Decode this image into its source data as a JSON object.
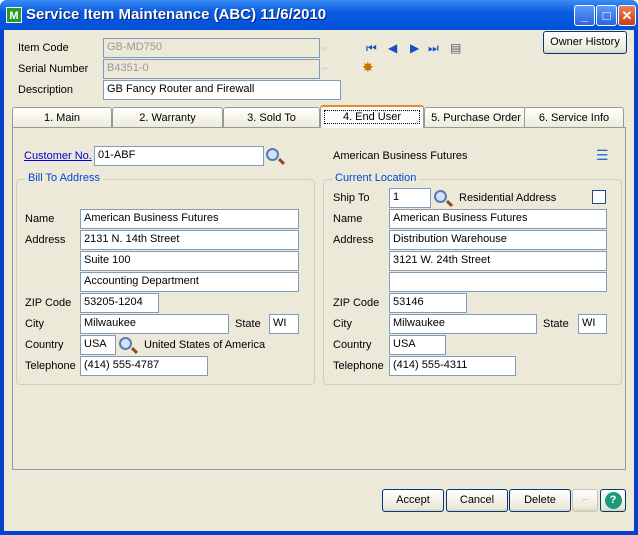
{
  "window": {
    "title": "Service Item Maintenance (ABC) 11/6/2010",
    "app_icon": "M"
  },
  "header": {
    "item_code_label": "Item Code",
    "item_code": "GB-MD750",
    "serial_label": "Serial Number",
    "serial": "B4351-0",
    "description_label": "Description",
    "description": "GB Fancy Router and Firewall",
    "owner_history": "Owner History"
  },
  "tabs": [
    "1. Main",
    "2. Warranty",
    "3. Sold To",
    "4. End User",
    "5. Purchase Order",
    "6. Service Info"
  ],
  "selected_tab": 3,
  "customer": {
    "label": "Customer No.",
    "value": "01-ABF",
    "name": "American Business Futures"
  },
  "bill_to": {
    "title": "Bill To Address",
    "name_label": "Name",
    "name": "American Business Futures",
    "address_label": "Address",
    "address1": "2131 N. 14th Street",
    "address2": "Suite 100",
    "address3": "Accounting Department",
    "zip_label": "ZIP Code",
    "zip": "53205-1204",
    "city_label": "City",
    "city": "Milwaukee",
    "state_label": "State",
    "state": "WI",
    "country_label": "Country",
    "country": "USA",
    "country_name": "United States of America",
    "phone_label": "Telephone",
    "phone": "(414) 555-4787"
  },
  "current_location": {
    "title": "Current Location",
    "ship_to_label": "Ship To",
    "ship_to": "1",
    "residential_label": "Residential Address",
    "residential": false,
    "name_label": "Name",
    "name": "American Business Futures",
    "address_label": "Address",
    "address1": "Distribution Warehouse",
    "address2": "3121 W. 24th Street",
    "address3": "",
    "zip_label": "ZIP Code",
    "zip": "53146",
    "city_label": "City",
    "city": "Milwaukee",
    "state_label": "State",
    "state": "WI",
    "country_label": "Country",
    "country": "USA",
    "phone_label": "Telephone",
    "phone": "(414) 555-4311"
  },
  "footer": {
    "accept": "Accept",
    "cancel": "Cancel",
    "delete": "Delete",
    "help": "?"
  }
}
